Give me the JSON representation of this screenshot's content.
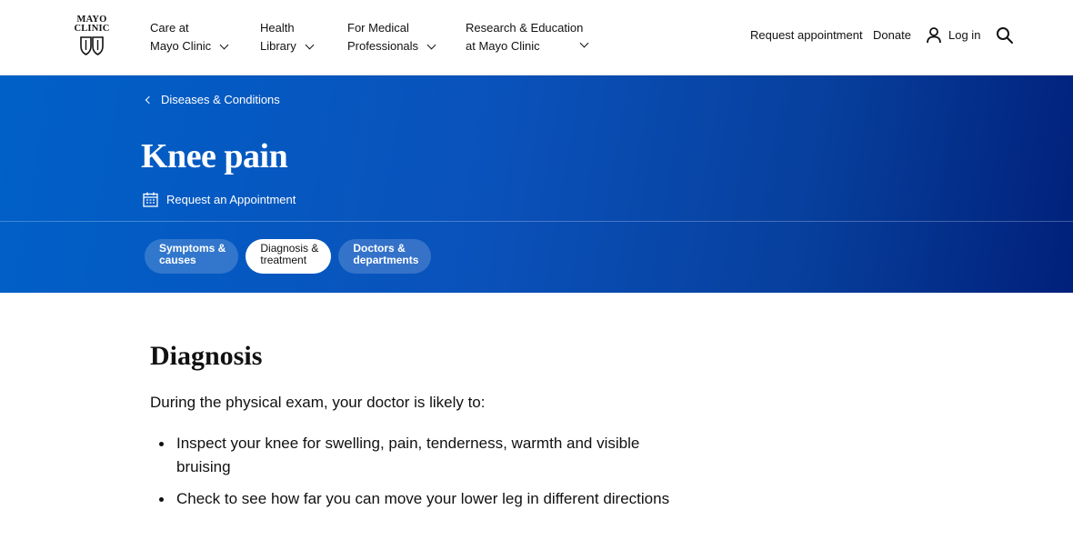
{
  "header": {
    "logo_line1": "MAYO",
    "logo_line2": "CLINIC",
    "nav": [
      {
        "line1": "Care at",
        "line2": "Mayo Clinic"
      },
      {
        "line1": "Health",
        "line2": "Library"
      },
      {
        "line1": "For Medical",
        "line2": "Professionals"
      },
      {
        "line1": "Research & Education",
        "line2": "at Mayo Clinic"
      }
    ],
    "request_appointment": "Request appointment",
    "donate": "Donate",
    "login": "Log in"
  },
  "hero": {
    "breadcrumb": "Diseases & Conditions",
    "title": "Knee pain",
    "request_link": "Request an Appointment",
    "tabs": [
      {
        "line1": "Symptoms &",
        "line2": "causes",
        "active": false
      },
      {
        "line1": "Diagnosis &",
        "line2": "treatment",
        "active": true
      },
      {
        "line1": "Doctors &",
        "line2": "departments",
        "active": false
      }
    ]
  },
  "main": {
    "heading": "Diagnosis",
    "intro": "During the physical exam, your doctor is likely to:",
    "bullets": [
      "Inspect your knee for swelling, pain, tenderness, warmth and visible bruising",
      "Check to see how far you can move your lower leg in different directions"
    ]
  },
  "colors": {
    "hero_blue": "#0a52bb",
    "hero_dark": "#00207a"
  }
}
